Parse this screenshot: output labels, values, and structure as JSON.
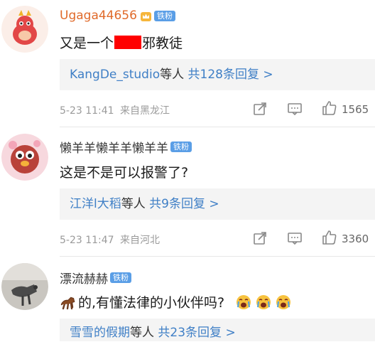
{
  "comments": [
    {
      "username": "Ugaga44656",
      "badge": "铁粉",
      "has_crown": true,
      "username_color": "#e06a2a",
      "text_before": "又是一个",
      "text_after": "邪教徒",
      "reply_user": "KangDe_studio",
      "reply_etc": "等人",
      "reply_count": "共128条回复 >",
      "timestamp": "5-23 11:41",
      "location": "来自黑龙江",
      "likes": "1565"
    },
    {
      "username": "懒羊羊懒羊羊懒羊羊",
      "badge": "铁粉",
      "username_color": "#333333",
      "text": "这是不是可以报警了?",
      "reply_user": "江洋l大稻",
      "reply_etc": "等人",
      "reply_count": "共9条回复 >",
      "timestamp": "5-23 11:47",
      "location": "来自河北",
      "likes": "3360"
    },
    {
      "username": "漂流赫赫",
      "badge": "铁粉",
      "username_color": "#333333",
      "text": "的,有懂法律的小伙伴吗?",
      "reply_user": "雪雪的假期",
      "reply_etc": "等人",
      "reply_count": "共23条回复 >"
    }
  ]
}
